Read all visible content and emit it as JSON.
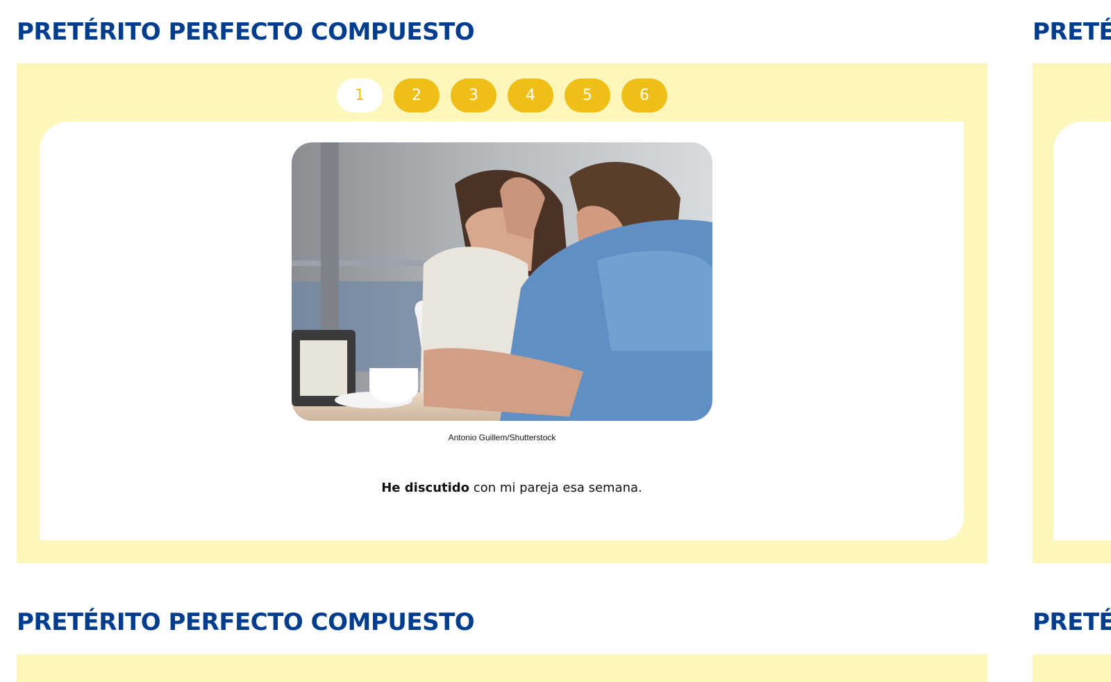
{
  "slides": [
    {
      "title": "PRETÉRITO PERFECTO COMPUESTO",
      "pagination": {
        "active": "1",
        "pages": [
          "1",
          "2",
          "3",
          "4",
          "5",
          "6"
        ]
      },
      "image": {
        "alt": "",
        "credit": "Antonio Guillem/Shutterstock"
      },
      "sentence": {
        "bold": "He discutido",
        "rest": " con mi pareja esa semana."
      }
    },
    {
      "title": "PRETÉRITO PERFECTO COMPUESTO"
    },
    {
      "title": "PRETÉRITO PERFECTO COMPUESTO"
    },
    {
      "title": "PRETÉRITO PERFECTO COMPUESTO"
    }
  ],
  "colors": {
    "heading": "#003d8f",
    "panel": "#fef7bb",
    "pager_button": "#efbf17",
    "pager_active_bg": "#ffffff"
  }
}
